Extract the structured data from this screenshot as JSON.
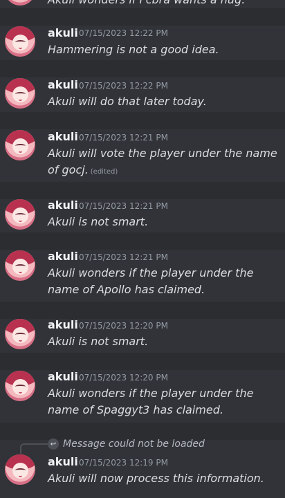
{
  "top_partial_text": "Akuli wonders if Fcbra wants a hug.",
  "author": "akuli",
  "edited_label": "(edited)",
  "reply_text": "Message could not be loaded",
  "messages": [
    {
      "timestamp": "07/15/2023 12:22 PM",
      "text": "Hammering is not a good idea."
    },
    {
      "timestamp": "07/15/2023 12:22 PM",
      "text": "Akuli will do that later today."
    },
    {
      "timestamp": "07/15/2023 12:21 PM",
      "text": "Akuli will vote the player under the name of gocj."
    },
    {
      "timestamp": "07/15/2023 12:21 PM",
      "text": "Akuli is not smart."
    },
    {
      "timestamp": "07/15/2023 12:21 PM",
      "text": "Akuli wonders if the player under the name of Apollo has claimed."
    },
    {
      "timestamp": "07/15/2023 12:20 PM",
      "text": "Akuli is not smart."
    },
    {
      "timestamp": "07/15/2023 12:20 PM",
      "text": "Akuli wonders if the player under the name of Spaggyt3 has claimed."
    },
    {
      "timestamp": "07/15/2023 12:19 PM",
      "text": "Akuli will now process this information."
    }
  ]
}
